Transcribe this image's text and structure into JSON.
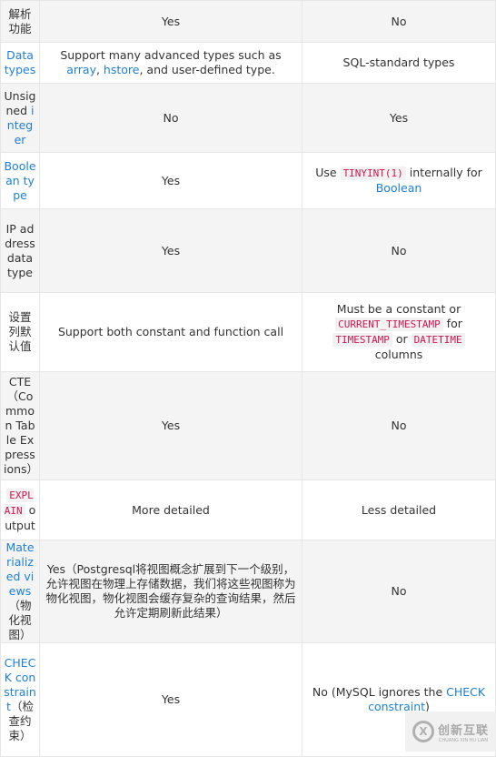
{
  "table": {
    "rows": [
      {
        "cells": [
          [
            {
              "t": "解析功能"
            }
          ],
          [
            {
              "t": "Yes"
            }
          ],
          [
            {
              "t": "No"
            }
          ]
        ]
      },
      {
        "cells": [
          [
            {
              "t": "Data types",
              "k": "link"
            }
          ],
          [
            {
              "t": "Support many advanced types such as "
            },
            {
              "t": "array",
              "k": "link"
            },
            {
              "t": ", "
            },
            {
              "t": "hstore",
              "k": "link"
            },
            {
              "t": ", and user-defined type."
            }
          ],
          [
            {
              "t": "SQL-standard types"
            }
          ]
        ]
      },
      {
        "cells": [
          [
            {
              "t": "Unsigned "
            },
            {
              "t": "integer",
              "k": "link"
            }
          ],
          [
            {
              "t": "No"
            }
          ],
          [
            {
              "t": "Yes"
            }
          ]
        ]
      },
      {
        "cells": [
          [
            {
              "t": "Boolean type",
              "k": "link"
            }
          ],
          [
            {
              "t": "Yes"
            }
          ],
          [
            {
              "t": "Use "
            },
            {
              "t": "TINYINT(1)",
              "k": "code"
            },
            {
              "t": " internally for "
            },
            {
              "t": "Boolean",
              "k": "link"
            }
          ]
        ]
      },
      {
        "cells": [
          [
            {
              "t": "IP address data type"
            }
          ],
          [
            {
              "t": "Yes"
            }
          ],
          [
            {
              "t": "No"
            }
          ]
        ]
      },
      {
        "cells": [
          [
            {
              "t": "设置列默认值"
            }
          ],
          [
            {
              "t": "Support both constant and function call"
            }
          ],
          [
            {
              "t": "Must be a constant or "
            },
            {
              "t": "CURRENT_TIMESTAMP",
              "k": "code"
            },
            {
              "t": " for "
            },
            {
              "t": "TIMESTAMP",
              "k": "code"
            },
            {
              "t": " or "
            },
            {
              "t": "DATETIME",
              "k": "code"
            },
            {
              "t": " columns"
            }
          ]
        ]
      },
      {
        "cells": [
          [
            {
              "t": "CTE（Common Table Expressions）"
            }
          ],
          [
            {
              "t": "Yes"
            }
          ],
          [
            {
              "t": "No"
            }
          ]
        ]
      },
      {
        "cells": [
          [
            {
              "t": "EXPLAIN",
              "k": "code"
            },
            {
              "t": " output"
            }
          ],
          [
            {
              "t": "More detailed"
            }
          ],
          [
            {
              "t": "Less detailed"
            }
          ]
        ]
      },
      {
        "cells": [
          [
            {
              "t": "Materialized views",
              "k": "link"
            },
            {
              "t": "（物化视图）"
            }
          ],
          [
            {
              "t": "Yes（Postgresql将视图概念扩展到下一个级别，允许视图在物理上存储数据，我们将这些视图称为物化视图，物化视图会缓存复杂的查询结果，然后允许定期刷新此结果）"
            }
          ],
          [
            {
              "t": "No"
            }
          ]
        ]
      },
      {
        "cells": [
          [
            {
              "t": "CHECK constraint",
              "k": "link"
            },
            {
              "t": "（检查约束）"
            }
          ],
          [
            {
              "t": "Yes"
            }
          ],
          [
            {
              "t": "No (MySQL ignores the "
            },
            {
              "t": "CHECK constraint",
              "k": "link"
            },
            {
              "t": ")"
            }
          ]
        ]
      }
    ]
  },
  "watermark": {
    "brand_cn": "创新互联",
    "brand_en": "CHUANG XIN HU LIAN"
  },
  "colors": {
    "link": "#1e7fd6",
    "code": "#d1144d",
    "row_alt": "#f4f4f4"
  }
}
